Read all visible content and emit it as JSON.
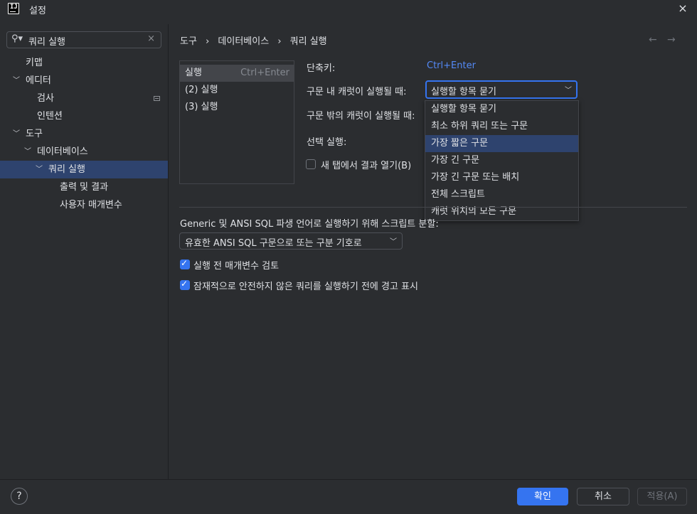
{
  "window": {
    "title": "설정",
    "close_icon": "×"
  },
  "sidebar": {
    "search": {
      "value": "쿼리 실행",
      "icon": "search-icon",
      "clear": "×"
    },
    "items": [
      {
        "label": "키맵"
      },
      {
        "label": "에디터"
      },
      {
        "label": "검사"
      },
      {
        "label": "인텐션"
      },
      {
        "label": "도구"
      },
      {
        "label": "데이터베이스"
      },
      {
        "label": "쿼리 실행"
      },
      {
        "label": "출력 및 결과"
      },
      {
        "label": "사용자 매개변수"
      }
    ]
  },
  "breadcrumb": {
    "part1": "도구",
    "sep": "›",
    "part2": "데이터베이스",
    "part3": "쿼리 실행"
  },
  "nav": {
    "back": "←",
    "forward": "→"
  },
  "actions": [
    {
      "label": "실행",
      "shortcut": "Ctrl+Enter"
    },
    {
      "label": "(2) 실행"
    },
    {
      "label": "(3) 실행"
    }
  ],
  "settings": {
    "shortcut_label": "단축키:",
    "shortcut_value": "Ctrl+Enter",
    "caret_inside_label": "구문 내 캐럿이 실행될 때:",
    "caret_inside_value": "실행할 항목 묻기",
    "caret_outside_label": "구문 밖의 캐럿이 실행될 때:",
    "selection_label": "선택 실행:",
    "new_tab_label": "새 탭에서 결과 열기(B)",
    "new_tab_checked": false
  },
  "dropdown": {
    "options": [
      "실행할 항목 묻기",
      "최소 하위 쿼리 또는 구문",
      "가장 짧은 구문",
      "가장 긴 구문",
      "가장 긴 구문 또는 배치",
      "전체 스크립트",
      "캐럿 위치의 모든 구문"
    ],
    "highlighted": "가장 짧은 구문"
  },
  "script_split": {
    "label": "Generic 및 ANSI SQL 파생 언어로 실행하기 위해 스크립트 분할:",
    "value": "유효한 ANSI SQL 구문으로 또는 구분 기호로"
  },
  "checks": [
    {
      "label": "실행 전 매개변수 검토",
      "checked": true
    },
    {
      "label": "잠재적으로 안전하지 않은 쿼리를 실행하기 전에 경고 표시",
      "checked": true
    }
  ],
  "buttons": {
    "help": "?",
    "ok": "확인",
    "cancel": "취소",
    "apply": "적용(A)"
  },
  "colors": {
    "accent": "#3574f0",
    "link": "#548af7",
    "selection": "#2e436e",
    "background": "#2b2d30"
  }
}
